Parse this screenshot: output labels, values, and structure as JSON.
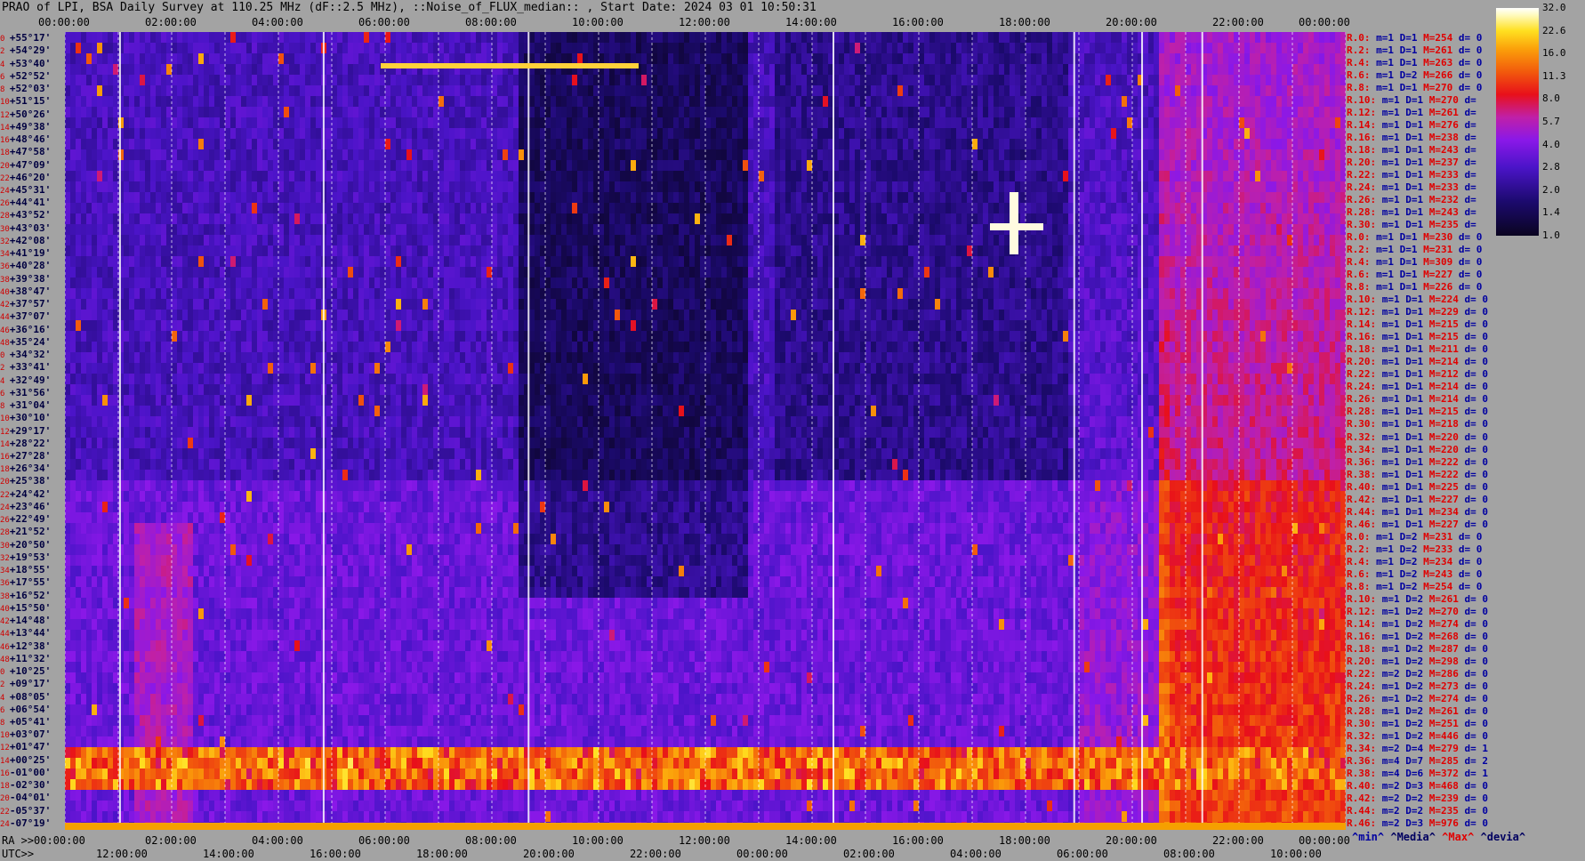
{
  "header": {
    "title": "PRAO of LPI, BSA Daily Survey at 110.25 MHz (dF::2.5 MHz), ::Noise_of_FLUX_median:: , Start Date: 2024 03 01 10:50:31"
  },
  "chart_data": {
    "type": "heatmap",
    "title": "PRAO of LPI, BSA Daily Survey at 110.25 MHz (dF::2.5 MHz), ::Noise_of_FLUX_median:: , Start Date: 2024 03 01 10:50:31",
    "x_top_ticks": [
      "00:00:00",
      "02:00:00",
      "04:00:00",
      "06:00:00",
      "08:00:00",
      "10:00:00",
      "12:00:00",
      "14:00:00",
      "16:00:00",
      "18:00:00",
      "20:00:00",
      "22:00:00",
      "00:00:00"
    ],
    "ra_axis": {
      "prefix": "RA >>",
      "ticks": [
        "00:00:00",
        "02:00:00",
        "04:00:00",
        "06:00:00",
        "08:00:00",
        "10:00:00",
        "12:00:00",
        "14:00:00",
        "16:00:00",
        "18:00:00",
        "20:00:00",
        "22:00:00",
        "00:00:00"
      ]
    },
    "utc_axis": {
      "prefix": "UTC>>",
      "ticks": [
        "12:00:00",
        "14:00:00",
        "16:00:00",
        "18:00:00",
        "20:00:00",
        "22:00:00",
        "00:00:00",
        "02:00:00",
        "04:00:00",
        "06:00:00",
        "08:00:00",
        "10:00:00"
      ]
    },
    "declinations": [
      "+55°17'",
      "+54°29'",
      "+53°40'",
      "+52°52'",
      "+52°03'",
      "+51°15'",
      "+50°26'",
      "+49°38'",
      "+48°46'",
      "+47°58'",
      "+47°09'",
      "+46°20'",
      "+45°31'",
      "+44°41'",
      "+43°52'",
      "+43°03'",
      "+42°08'",
      "+41°19'",
      "+40°28'",
      "+39°38'",
      "+38°47'",
      "+37°57'",
      "+37°07'",
      "+36°16'",
      "+35°24'",
      "+34°32'",
      "+33°41'",
      "+32°49'",
      "+31°56'",
      "+31°04'",
      "+30°10'",
      "+29°17'",
      "+28°22'",
      "+27°28'",
      "+26°34'",
      "+25°38'",
      "+24°42'",
      "+23°46'",
      "+22°49'",
      "+21°52'",
      "+20°50'",
      "+19°53'",
      "+18°55'",
      "+17°55'",
      "+16°52'",
      "+15°50'",
      "+14°48'",
      "+13°44'",
      "+12°38'",
      "+11°32'",
      "+10°25'",
      "+09°17'",
      "+08°05'",
      "+06°54'",
      "+05°41'",
      "+03°07'",
      "+01°47'",
      "+00°25'",
      "-01°00'",
      "-02°30'",
      "-04°01'",
      "-05°37'",
      "-07°19'"
    ],
    "row_indices": [
      "0",
      "2",
      "4",
      "6",
      "8",
      "10",
      "12",
      "14",
      "16",
      "18",
      "20",
      "22",
      "24",
      "26",
      "28",
      "30",
      "32",
      "34",
      "36",
      "38",
      "40",
      "42",
      "44",
      "46",
      "48",
      "0",
      "2",
      "4",
      "6",
      "8",
      "10",
      "12",
      "14",
      "16",
      "18",
      "20",
      "22",
      "24",
      "26",
      "28",
      "30",
      "32",
      "34",
      "36",
      "38",
      "40",
      "42",
      "44",
      "46",
      "48",
      "0",
      "2",
      "4",
      "6",
      "8",
      "10",
      "12",
      "14",
      "16",
      "18",
      "20",
      "22",
      "24"
    ],
    "rows": [
      {
        "r": "R.0:",
        "m": "m=1",
        "D": "D=1",
        "M": "M=254",
        "d": "d= 0"
      },
      {
        "r": "R.2:",
        "m": "m=1",
        "D": "D=1",
        "M": "M=261",
        "d": "d= 0"
      },
      {
        "r": "R.4:",
        "m": "m=1",
        "D": "D=1",
        "M": "M=263",
        "d": "d= 0"
      },
      {
        "r": "R.6:",
        "m": "m=1",
        "D": "D=2",
        "M": "M=266",
        "d": "d= 0"
      },
      {
        "r": "R.8:",
        "m": "m=1",
        "D": "D=1",
        "M": "M=270",
        "d": "d= 0"
      },
      {
        "r": "R.10:",
        "m": "m=1",
        "D": "D=1",
        "M": "M=270",
        "d": "d="
      },
      {
        "r": "R.12:",
        "m": "m=1",
        "D": "D=1",
        "M": "M=261",
        "d": "d="
      },
      {
        "r": "R.14:",
        "m": "m=1",
        "D": "D=1",
        "M": "M=276",
        "d": "d="
      },
      {
        "r": "R.16:",
        "m": "m=1",
        "D": "D=1",
        "M": "M=238",
        "d": "d="
      },
      {
        "r": "R.18:",
        "m": "m=1",
        "D": "D=1",
        "M": "M=243",
        "d": "d="
      },
      {
        "r": "R.20:",
        "m": "m=1",
        "D": "D=1",
        "M": "M=237",
        "d": "d="
      },
      {
        "r": "R.22:",
        "m": "m=1",
        "D": "D=1",
        "M": "M=233",
        "d": "d="
      },
      {
        "r": "R.24:",
        "m": "m=1",
        "D": "D=1",
        "M": "M=233",
        "d": "d="
      },
      {
        "r": "R.26:",
        "m": "m=1",
        "D": "D=1",
        "M": "M=232",
        "d": "d="
      },
      {
        "r": "R.28:",
        "m": "m=1",
        "D": "D=1",
        "M": "M=243",
        "d": "d="
      },
      {
        "r": "R.30:",
        "m": "m=1",
        "D": "D=1",
        "M": "M=235",
        "d": "d="
      },
      {
        "r": "R.0:",
        "m": "m=1",
        "D": "D=1",
        "M": "M=230",
        "d": "d= 0"
      },
      {
        "r": "R.2:",
        "m": "m=1",
        "D": "D=1",
        "M": "M=231",
        "d": "d= 0"
      },
      {
        "r": "R.4:",
        "m": "m=1",
        "D": "D=1",
        "M": "M=309",
        "d": "d= 0"
      },
      {
        "r": "R.6:",
        "m": "m=1",
        "D": "D=1",
        "M": "M=227",
        "d": "d= 0"
      },
      {
        "r": "R.8:",
        "m": "m=1",
        "D": "D=1",
        "M": "M=226",
        "d": "d= 0"
      },
      {
        "r": "R.10:",
        "m": "m=1",
        "D": "D=1",
        "M": "M=224",
        "d": "d= 0"
      },
      {
        "r": "R.12:",
        "m": "m=1",
        "D": "D=1",
        "M": "M=229",
        "d": "d= 0"
      },
      {
        "r": "R.14:",
        "m": "m=1",
        "D": "D=1",
        "M": "M=215",
        "d": "d= 0"
      },
      {
        "r": "R.16:",
        "m": "m=1",
        "D": "D=1",
        "M": "M=215",
        "d": "d= 0"
      },
      {
        "r": "R.18:",
        "m": "m=1",
        "D": "D=1",
        "M": "M=211",
        "d": "d= 0"
      },
      {
        "r": "R.20:",
        "m": "m=1",
        "D": "D=1",
        "M": "M=214",
        "d": "d= 0"
      },
      {
        "r": "R.22:",
        "m": "m=1",
        "D": "D=1",
        "M": "M=212",
        "d": "d= 0"
      },
      {
        "r": "R.24:",
        "m": "m=1",
        "D": "D=1",
        "M": "M=214",
        "d": "d= 0"
      },
      {
        "r": "R.26:",
        "m": "m=1",
        "D": "D=1",
        "M": "M=214",
        "d": "d= 0"
      },
      {
        "r": "R.28:",
        "m": "m=1",
        "D": "D=1",
        "M": "M=215",
        "d": "d= 0"
      },
      {
        "r": "R.30:",
        "m": "m=1",
        "D": "D=1",
        "M": "M=218",
        "d": "d= 0"
      },
      {
        "r": "R.32:",
        "m": "m=1",
        "D": "D=1",
        "M": "M=220",
        "d": "d= 0"
      },
      {
        "r": "R.34:",
        "m": "m=1",
        "D": "D=1",
        "M": "M=220",
        "d": "d= 0"
      },
      {
        "r": "R.36:",
        "m": "m=1",
        "D": "D=1",
        "M": "M=222",
        "d": "d= 0"
      },
      {
        "r": "R.38:",
        "m": "m=1",
        "D": "D=1",
        "M": "M=222",
        "d": "d= 0"
      },
      {
        "r": "R.40:",
        "m": "m=1",
        "D": "D=1",
        "M": "M=225",
        "d": "d= 0"
      },
      {
        "r": "R.42:",
        "m": "m=1",
        "D": "D=1",
        "M": "M=227",
        "d": "d= 0"
      },
      {
        "r": "R.44:",
        "m": "m=1",
        "D": "D=1",
        "M": "M=234",
        "d": "d= 0"
      },
      {
        "r": "R.46:",
        "m": "m=1",
        "D": "D=1",
        "M": "M=227",
        "d": "d= 0"
      },
      {
        "r": "R.0:",
        "m": "m=1",
        "D": "D=2",
        "M": "M=231",
        "d": "d= 0"
      },
      {
        "r": "R.2:",
        "m": "m=1",
        "D": "D=2",
        "M": "M=233",
        "d": "d= 0"
      },
      {
        "r": "R.4:",
        "m": "m=1",
        "D": "D=2",
        "M": "M=234",
        "d": "d= 0"
      },
      {
        "r": "R.6:",
        "m": "m=1",
        "D": "D=2",
        "M": "M=243",
        "d": "d= 0"
      },
      {
        "r": "R.8:",
        "m": "m=1",
        "D": "D=2",
        "M": "M=254",
        "d": "d= 0"
      },
      {
        "r": "R.10:",
        "m": "m=1",
        "D": "D=2",
        "M": "M=261",
        "d": "d= 0"
      },
      {
        "r": "R.12:",
        "m": "m=1",
        "D": "D=2",
        "M": "M=270",
        "d": "d= 0"
      },
      {
        "r": "R.14:",
        "m": "m=1",
        "D": "D=2",
        "M": "M=274",
        "d": "d= 0"
      },
      {
        "r": "R.16:",
        "m": "m=1",
        "D": "D=2",
        "M": "M=268",
        "d": "d= 0"
      },
      {
        "r": "R.18:",
        "m": "m=1",
        "D": "D=2",
        "M": "M=287",
        "d": "d= 0"
      },
      {
        "r": "R.20:",
        "m": "m=1",
        "D": "D=2",
        "M": "M=298",
        "d": "d= 0"
      },
      {
        "r": "R.22:",
        "m": "m=2",
        "D": "D=2",
        "M": "M=286",
        "d": "d= 0"
      },
      {
        "r": "R.24:",
        "m": "m=1",
        "D": "D=2",
        "M": "M=273",
        "d": "d= 0"
      },
      {
        "r": "R.26:",
        "m": "m=1",
        "D": "D=2",
        "M": "M=274",
        "d": "d= 0"
      },
      {
        "r": "R.28:",
        "m": "m=1",
        "D": "D=2",
        "M": "M=261",
        "d": "d= 0"
      },
      {
        "r": "R.30:",
        "m": "m=1",
        "D": "D=2",
        "M": "M=251",
        "d": "d= 0"
      },
      {
        "r": "R.32:",
        "m": "m=1",
        "D": "D=2",
        "M": "M=446",
        "d": "d= 0"
      },
      {
        "r": "R.34:",
        "m": "m=2",
        "D": "D=4",
        "M": "M=279",
        "d": "d= 1"
      },
      {
        "r": "R.36:",
        "m": "m=4",
        "D": "D=7",
        "M": "M=285",
        "d": "d= 2"
      },
      {
        "r": "R.38:",
        "m": "m=4",
        "D": "D=6",
        "M": "M=372",
        "d": "d= 1"
      },
      {
        "r": "R.40:",
        "m": "m=2",
        "D": "D=3",
        "M": "M=468",
        "d": "d= 0"
      },
      {
        "r": "R.42:",
        "m": "m=2",
        "D": "D=2",
        "M": "M=239",
        "d": "d= 0"
      },
      {
        "r": "R.44:",
        "m": "m=2",
        "D": "D=2",
        "M": "M=235",
        "d": "d= 0"
      },
      {
        "r": "R.46:",
        "m": "m=2",
        "D": "D=3",
        "M": "M=976",
        "d": "d= 0"
      }
    ],
    "colorbar": {
      "ticks": [
        "32.0",
        "22.6",
        "16.0",
        "11.3",
        "8.0",
        "5.7",
        "4.0",
        "2.8",
        "2.0",
        "1.4",
        "1.0"
      ],
      "scale": "log",
      "min": 1.0,
      "max": 32.0
    },
    "legend": {
      "min": "^min^",
      "median": "^Media^",
      "max": "^Max^",
      "deviation": "^devia^"
    },
    "colors": {
      "background": "#a3a3a3",
      "low": "#0d0424",
      "mid": "#7a18e0",
      "high": "#e8101a",
      "peak": "#ffffff"
    }
  }
}
